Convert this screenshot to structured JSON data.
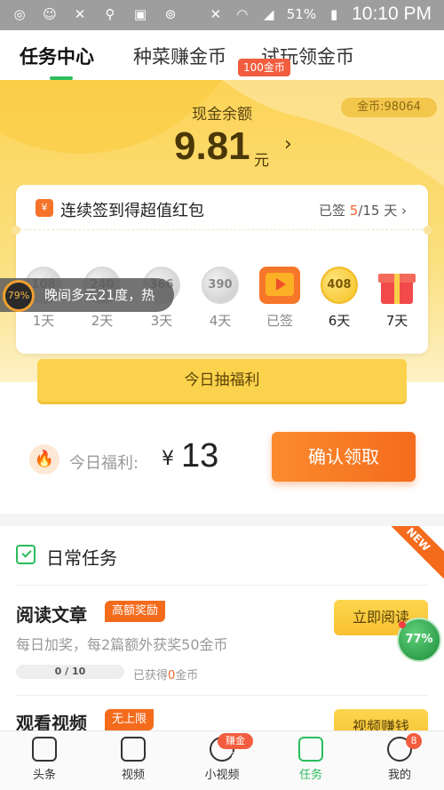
{
  "status_bar": {
    "battery_pct": "51%",
    "time": "10:10 PM"
  },
  "tabs": [
    {
      "label": "任务中心",
      "active": true
    },
    {
      "label": "种菜赚金币",
      "active": false
    },
    {
      "label": "试玩领金币",
      "active": false
    }
  ],
  "wallet": {
    "coin_balance": "金币:98064",
    "cash_label": "现金余额",
    "cash_value": "9.81",
    "cash_unit": "元",
    "arrow": "›"
  },
  "sign_in": {
    "title": "连续签到得超值红包",
    "status_prefix": "已签 ",
    "signed_days": "5",
    "status_suffix": "/15 天 ›",
    "reward_tag": "100金币",
    "days": [
      {
        "coin": "108",
        "label": "1天",
        "state": "claimed"
      },
      {
        "coin": "240",
        "label": "2天",
        "state": "claimed"
      },
      {
        "coin": "366",
        "label": "3天",
        "state": "claimed"
      },
      {
        "coin": "390",
        "label": "4天",
        "state": "claimed"
      },
      {
        "coin": "",
        "label": "已签",
        "state": "video"
      },
      {
        "coin": "408",
        "label": "6天",
        "state": "next"
      },
      {
        "coin": "",
        "label": "7天",
        "state": "gift"
      }
    ]
  },
  "toast": {
    "badge": "79%",
    "text": "晚间多云21度，热"
  },
  "lottery": {
    "label": "今日抽福利"
  },
  "welfare": {
    "label": "今日福利:",
    "currency": "¥",
    "value": "13",
    "confirm_label": "确认领取"
  },
  "daily_tasks": {
    "title": "日常任务",
    "new_badge": "NEW",
    "items": [
      {
        "title": "阅读文章",
        "tag": "高额奖励",
        "desc": "每日加奖，每2篇额外获奖50金币",
        "progress": "0 / 10",
        "progress_value": 0,
        "earned_prefix": "已获得",
        "earned": "0",
        "earned_suffix": "金币",
        "button": "立即阅读"
      },
      {
        "title": "观看视频",
        "tag": "无上限",
        "button": "视频赚钱"
      }
    ]
  },
  "float_ball": {
    "label": "77%"
  },
  "bottom_nav": [
    {
      "label": "头条",
      "icon": "headline-icon",
      "active": false
    },
    {
      "label": "视频",
      "icon": "video-icon",
      "active": false
    },
    {
      "label": "小视频",
      "icon": "short-video-icon",
      "active": false,
      "badge": "赚金币"
    },
    {
      "label": "任务",
      "icon": "task-icon",
      "active": true
    },
    {
      "label": "我的",
      "icon": "profile-icon",
      "active": false,
      "count": "8"
    }
  ],
  "colors": {
    "brand_green": "#2bbd5c",
    "accent_orange": "#f46b1c",
    "header_yellow": "#fcd356"
  }
}
